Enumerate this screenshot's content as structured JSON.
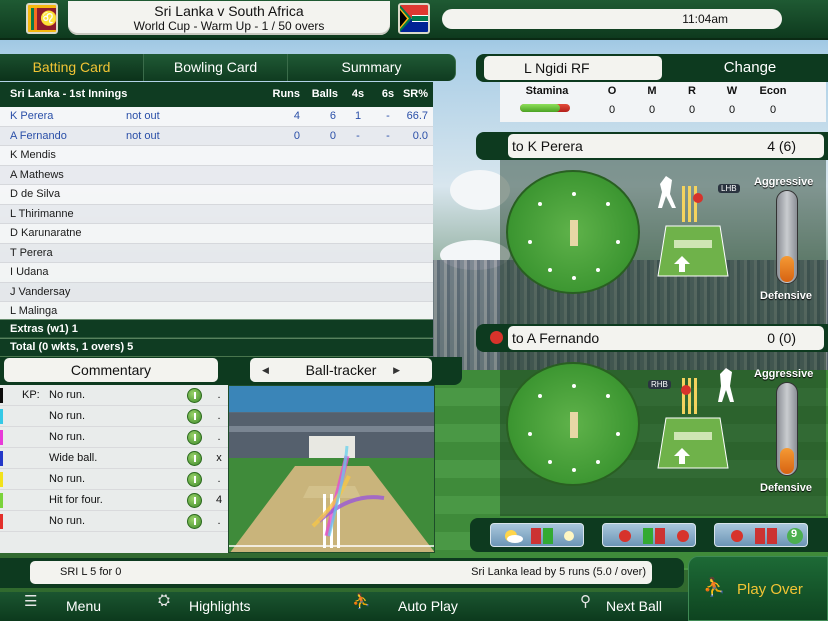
{
  "header": {
    "match_title": "Sri Lanka v South Africa",
    "match_subtitle": "World Cup - Warm Up - 1 / 50 overs",
    "time": "11:04am"
  },
  "tabs": [
    {
      "label": "Batting Card",
      "active": true
    },
    {
      "label": "Bowling Card",
      "active": false
    },
    {
      "label": "Summary",
      "active": false
    }
  ],
  "batting": {
    "innings_label": "Sri Lanka - 1st Innings",
    "columns": [
      "Runs",
      "Balls",
      "4s",
      "6s",
      "SR%"
    ],
    "rows": [
      {
        "name": "K Perera",
        "status": "not out",
        "runs": "4",
        "balls": "6",
        "fours": "1",
        "sixes": "-",
        "sr": "66.7",
        "batting": true
      },
      {
        "name": "A Fernando",
        "status": "not out",
        "runs": "0",
        "balls": "0",
        "fours": "-",
        "sixes": "-",
        "sr": "0.0",
        "batting": true
      },
      {
        "name": "K Mendis",
        "status": "",
        "runs": "",
        "balls": "",
        "fours": "",
        "sixes": "",
        "sr": "",
        "batting": false
      },
      {
        "name": "A Mathews",
        "status": "",
        "runs": "",
        "balls": "",
        "fours": "",
        "sixes": "",
        "sr": "",
        "batting": false
      },
      {
        "name": "D de Silva",
        "status": "",
        "runs": "",
        "balls": "",
        "fours": "",
        "sixes": "",
        "sr": "",
        "batting": false
      },
      {
        "name": "L Thirimanne",
        "status": "",
        "runs": "",
        "balls": "",
        "fours": "",
        "sixes": "",
        "sr": "",
        "batting": false
      },
      {
        "name": "D Karunaratne",
        "status": "",
        "runs": "",
        "balls": "",
        "fours": "",
        "sixes": "",
        "sr": "",
        "batting": false
      },
      {
        "name": "T Perera",
        "status": "",
        "runs": "",
        "balls": "",
        "fours": "",
        "sixes": "",
        "sr": "",
        "batting": false
      },
      {
        "name": "I Udana",
        "status": "",
        "runs": "",
        "balls": "",
        "fours": "",
        "sixes": "",
        "sr": "",
        "batting": false
      },
      {
        "name": "J Vandersay",
        "status": "",
        "runs": "",
        "balls": "",
        "fours": "",
        "sixes": "",
        "sr": "",
        "batting": false
      },
      {
        "name": "L Malinga",
        "status": "",
        "runs": "",
        "balls": "",
        "fours": "",
        "sixes": "",
        "sr": "",
        "batting": false
      }
    ],
    "extras": "Extras (w1) 1",
    "total": "Total (0 wkts, 1 overs) 5"
  },
  "commentary": {
    "tab_label": "Commentary",
    "tracker_label": "Ball-tracker",
    "kp_label": "KP:",
    "items": [
      {
        "text": "No run.",
        "result": ".",
        "color": "#0b0b0b"
      },
      {
        "text": "No run.",
        "result": ".",
        "color": "#35c9e6"
      },
      {
        "text": "No run.",
        "result": ".",
        "color": "#e83ad8"
      },
      {
        "text": "Wide ball.",
        "result": "x",
        "color": "#2438c8"
      },
      {
        "text": "No run.",
        "result": ".",
        "color": "#f2e21a"
      },
      {
        "text": "Hit for four.",
        "result": "4",
        "color": "#7bd33a"
      },
      {
        "text": "No run.",
        "result": ".",
        "color": "#e3302a"
      }
    ]
  },
  "bowler": {
    "name": "L Ngidi RF",
    "change_label": "Change",
    "stat_headers": [
      "Stamina",
      "O",
      "M",
      "R",
      "W",
      "Econ"
    ],
    "stats": [
      "0",
      "0",
      "0",
      "0",
      "0"
    ],
    "stamina": 0.8
  },
  "batter1": {
    "label": "to K Perera",
    "score": "4 (6)",
    "hand": "LHB",
    "aggressive_label": "Aggressive",
    "defensive_label": "Defensive",
    "aggression": 0.3
  },
  "batter2": {
    "label": "to A Fernando",
    "score": "0 (0)",
    "hand": "RHB",
    "aggressive_label": "Aggressive",
    "defensive_label": "Defensive",
    "aggression": 0.3
  },
  "tools": {
    "badge": "9"
  },
  "status": {
    "left": "SRI L  5 for 0",
    "right": "Sri Lanka lead by 5 runs (5.0 / over)"
  },
  "nav": {
    "menu": "Menu",
    "highlights": "Highlights",
    "auto_play": "Auto Play",
    "next_ball": "Next Ball",
    "play_over": "Play Over"
  },
  "colors": {
    "accent": "#f2c434",
    "panel_green": "#0d3a1f",
    "batting_blue": "#2a4fa8"
  }
}
